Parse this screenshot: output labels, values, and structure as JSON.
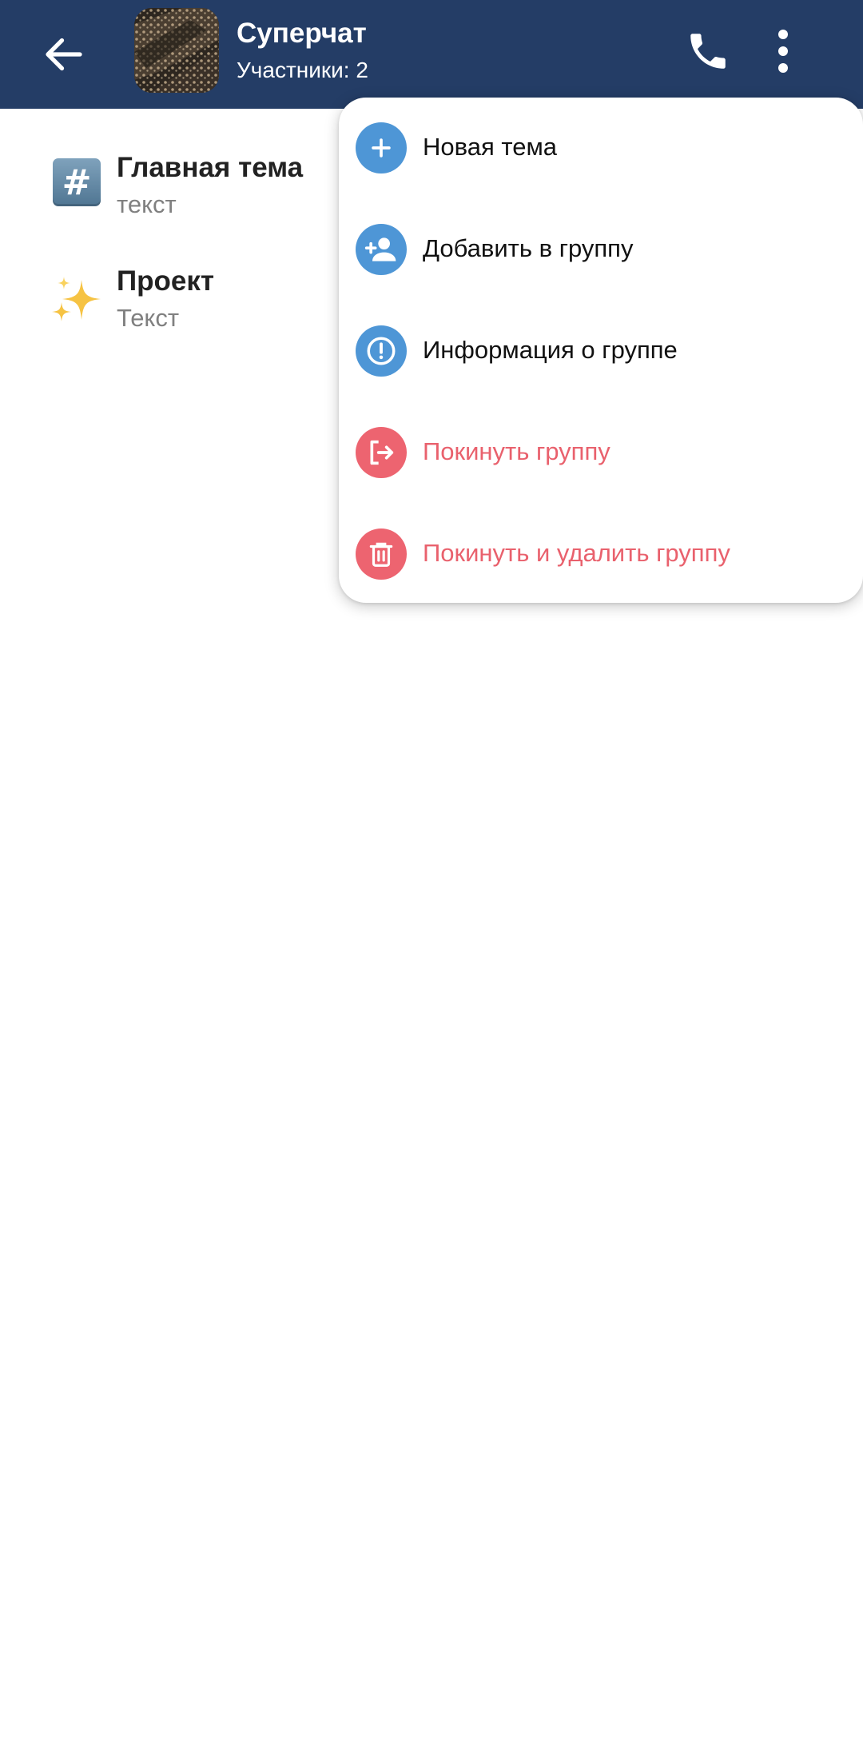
{
  "colors": {
    "header_bg": "#243d66",
    "menu_icon_blue": "#4e96d6",
    "menu_icon_red": "#ed6470",
    "menu_text_default": "#111111",
    "menu_text_danger": "#e9616d"
  },
  "header": {
    "back_icon": "arrow-left-icon",
    "title": "Суперчат",
    "subtitle": "Участники: 2",
    "call_icon": "phone-icon",
    "more_icon": "more-vertical-icon"
  },
  "topics": [
    {
      "icon": "hash-keycap-icon",
      "name": "Главная тема",
      "preview": "текст"
    },
    {
      "icon": "sparkles-icon",
      "name": "Проект",
      "preview": "Текст"
    }
  ],
  "menu": {
    "items": [
      {
        "icon": "plus-icon",
        "label": "Новая тема",
        "danger": false
      },
      {
        "icon": "add-user-icon",
        "label": "Добавить в группу",
        "danger": false
      },
      {
        "icon": "info-icon",
        "label": "Информация о группе",
        "danger": false
      },
      {
        "icon": "leave-icon",
        "label": "Покинуть группу",
        "danger": true
      },
      {
        "icon": "trash-icon",
        "label": "Покинуть и удалить группу",
        "danger": true
      }
    ]
  }
}
